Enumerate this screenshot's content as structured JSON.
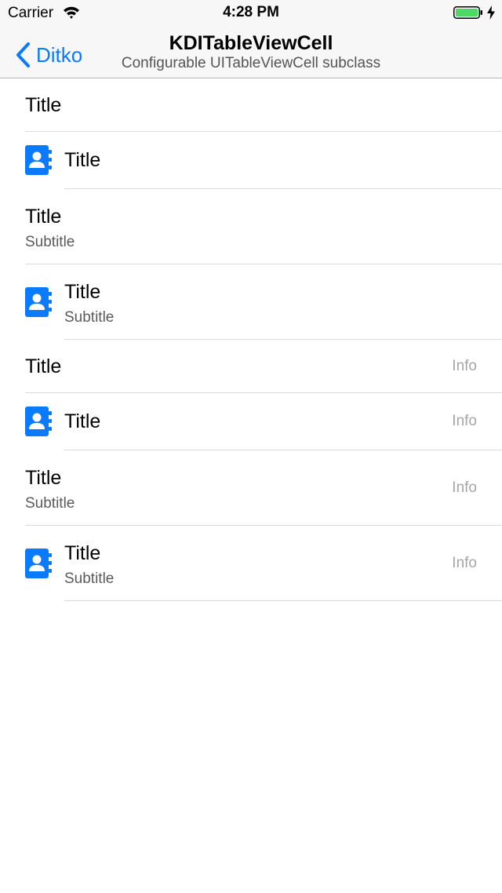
{
  "status_bar": {
    "carrier": "Carrier",
    "time": "4:28 PM"
  },
  "nav": {
    "back_label": "Ditko",
    "title": "KDITableViewCell",
    "subtitle": "Configurable UITableViewCell subclass"
  },
  "colors": {
    "accent": "#0a7aff",
    "battery": "#4cd964"
  },
  "icons": {
    "cell_icon": "contacts-book-icon"
  },
  "cells": [
    {
      "title": "Title"
    },
    {
      "title": "Title"
    },
    {
      "title": "Title",
      "subtitle": "Subtitle"
    },
    {
      "title": "Title",
      "subtitle": "Subtitle"
    },
    {
      "title": "Title",
      "info": "Info"
    },
    {
      "title": "Title",
      "info": "Info"
    },
    {
      "title": "Title",
      "subtitle": "Subtitle",
      "info": "Info"
    },
    {
      "title": "Title",
      "subtitle": "Subtitle",
      "info": "Info"
    }
  ]
}
